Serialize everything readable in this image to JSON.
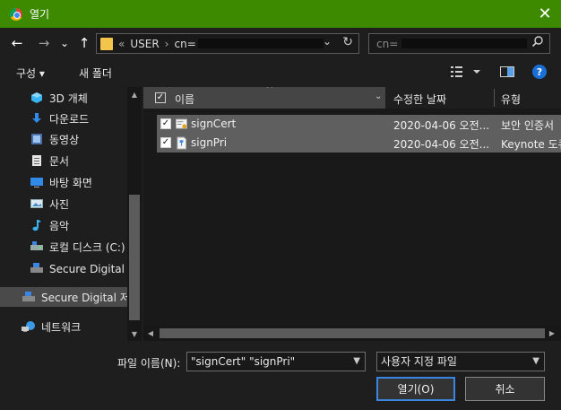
{
  "window": {
    "title": "열기",
    "close_glyph": "✕",
    "app_icon": "chrome-icon"
  },
  "nav": {
    "back_glyph": "←",
    "forward_glyph": "→",
    "recent_glyph": "⌄",
    "up_glyph": "↑",
    "address": {
      "overflow": "«",
      "segment_user": "USER",
      "sep": "›",
      "segment_cn": "cn=",
      "dropdown_glyph": "⌄",
      "refresh_glyph": "↻"
    },
    "search": {
      "placeholder": "cn=",
      "icon": "search-icon"
    }
  },
  "commands": {
    "organize": "구성 ▾",
    "new_folder": "새 폴더",
    "help": "?"
  },
  "sidebar": {
    "items": [
      {
        "label": "3D 개체",
        "icon": "cube-icon"
      },
      {
        "label": "다운로드",
        "icon": "download-icon"
      },
      {
        "label": "동영상",
        "icon": "video-icon"
      },
      {
        "label": "문서",
        "icon": "document-icon"
      },
      {
        "label": "바탕 화면",
        "icon": "desktop-icon"
      },
      {
        "label": "사진",
        "icon": "picture-icon"
      },
      {
        "label": "음악",
        "icon": "music-icon"
      },
      {
        "label": "로컬 디스크 (C:)",
        "icon": "drive-icon"
      },
      {
        "label": "Secure Digital 저장",
        "icon": "sd-card-icon"
      },
      {
        "label": "Secure Digital 저장",
        "icon": "sd-card-icon"
      },
      {
        "label": "네트워크",
        "icon": "network-icon"
      }
    ]
  },
  "columns": {
    "name": "이름",
    "modified": "수정한 날짜",
    "type": "유형",
    "sort_glyph": "^"
  },
  "files": [
    {
      "name": "signCert",
      "modified": "2020-04-06 오전...",
      "type": "보안 인증서",
      "checked": "✓"
    },
    {
      "name": "signPri",
      "modified": "2020-04-06 오전...",
      "type": "Keynote 도큐",
      "checked": "✓"
    }
  ],
  "footer": {
    "filename_label": "파일 이름(N):",
    "filename_value": "\"signCert\" \"signPri\"",
    "filetype_value": "사용자 지정 파일",
    "open_button": "열기(O)",
    "cancel_button": "취소"
  },
  "colors": {
    "titlebar": "#3d8a00",
    "selection": "#5f5f5f",
    "accent": "#3a86e0"
  }
}
